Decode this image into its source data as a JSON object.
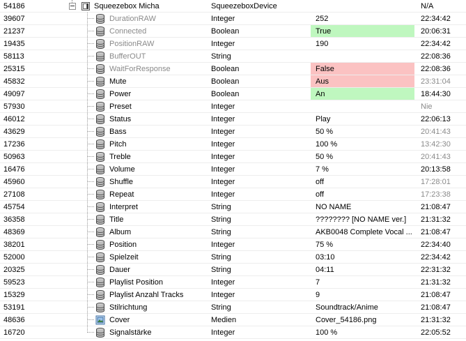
{
  "parent": {
    "id": "54186",
    "name": "Squeezebox Micha",
    "type": "SqueezeboxDevice",
    "value": "",
    "time": "N/A"
  },
  "rows": [
    {
      "id": "39607",
      "name": "DurationRAW",
      "type": "Integer",
      "value": "252",
      "time": "22:34:42",
      "icon": "variable-icon",
      "dim": true,
      "tdim": false,
      "hl": ""
    },
    {
      "id": "21237",
      "name": "Connected",
      "type": "Boolean",
      "value": "True",
      "time": "20:06:31",
      "icon": "variable-icon",
      "dim": true,
      "tdim": false,
      "hl": "green"
    },
    {
      "id": "19435",
      "name": "PositionRAW",
      "type": "Integer",
      "value": "190",
      "time": "22:34:42",
      "icon": "variable-icon",
      "dim": true,
      "tdim": false,
      "hl": ""
    },
    {
      "id": "58113",
      "name": "BufferOUT",
      "type": "String",
      "value": "",
      "time": "22:08:36",
      "icon": "variable-icon",
      "dim": true,
      "tdim": false,
      "hl": ""
    },
    {
      "id": "25315",
      "name": "WaitForResponse",
      "type": "Boolean",
      "value": "False",
      "time": "22:08:36",
      "icon": "variable-icon",
      "dim": true,
      "tdim": false,
      "hl": "red"
    },
    {
      "id": "45832",
      "name": "Mute",
      "type": "Boolean",
      "value": "Aus",
      "time": "23:31:04",
      "icon": "variable-icon",
      "dim": false,
      "tdim": true,
      "hl": "red"
    },
    {
      "id": "49097",
      "name": "Power",
      "type": "Boolean",
      "value": "An",
      "time": "18:44:30",
      "icon": "variable-icon",
      "dim": false,
      "tdim": false,
      "hl": "green"
    },
    {
      "id": "57930",
      "name": "Preset",
      "type": "Integer",
      "value": "",
      "time": "Nie",
      "icon": "variable-icon",
      "dim": false,
      "tdim": true,
      "hl": ""
    },
    {
      "id": "46012",
      "name": "Status",
      "type": "Integer",
      "value": "Play",
      "time": "22:06:13",
      "icon": "variable-icon",
      "dim": false,
      "tdim": false,
      "hl": ""
    },
    {
      "id": "43629",
      "name": "Bass",
      "type": "Integer",
      "value": "50 %",
      "time": "20:41:43",
      "icon": "variable-icon",
      "dim": false,
      "tdim": true,
      "hl": ""
    },
    {
      "id": "17236",
      "name": "Pitch",
      "type": "Integer",
      "value": "100 %",
      "time": "13:42:30",
      "icon": "variable-icon",
      "dim": false,
      "tdim": true,
      "hl": ""
    },
    {
      "id": "50963",
      "name": "Treble",
      "type": "Integer",
      "value": "50 %",
      "time": "20:41:43",
      "icon": "variable-icon",
      "dim": false,
      "tdim": true,
      "hl": ""
    },
    {
      "id": "16476",
      "name": "Volume",
      "type": "Integer",
      "value": "7 %",
      "time": "20:13:58",
      "icon": "variable-icon",
      "dim": false,
      "tdim": false,
      "hl": ""
    },
    {
      "id": "45960",
      "name": "Shuffle",
      "type": "Integer",
      "value": "off",
      "time": "17:28:01",
      "icon": "variable-icon",
      "dim": false,
      "tdim": true,
      "hl": ""
    },
    {
      "id": "27108",
      "name": "Repeat",
      "type": "Integer",
      "value": "off",
      "time": "17:23:38",
      "icon": "variable-icon",
      "dim": false,
      "tdim": true,
      "hl": ""
    },
    {
      "id": "45754",
      "name": "Interpret",
      "type": "String",
      "value": "NO NAME",
      "time": "21:08:47",
      "icon": "variable-icon",
      "dim": false,
      "tdim": false,
      "hl": ""
    },
    {
      "id": "36358",
      "name": "Title",
      "type": "String",
      "value": "???????? [NO NAME ver.]",
      "time": "21:31:32",
      "icon": "variable-icon",
      "dim": false,
      "tdim": false,
      "hl": ""
    },
    {
      "id": "48369",
      "name": "Album",
      "type": "String",
      "value": "AKB0048 Complete Vocal ...",
      "time": "21:08:47",
      "icon": "variable-icon",
      "dim": false,
      "tdim": false,
      "hl": ""
    },
    {
      "id": "38201",
      "name": "Position",
      "type": "Integer",
      "value": "75 %",
      "time": "22:34:40",
      "icon": "variable-icon",
      "dim": false,
      "tdim": false,
      "hl": ""
    },
    {
      "id": "52000",
      "name": "Spielzeit",
      "type": "String",
      "value": "03:10",
      "time": "22:34:42",
      "icon": "variable-icon",
      "dim": false,
      "tdim": false,
      "hl": ""
    },
    {
      "id": "20325",
      "name": "Dauer",
      "type": "String",
      "value": "04:11",
      "time": "22:31:32",
      "icon": "variable-icon",
      "dim": false,
      "tdim": false,
      "hl": ""
    },
    {
      "id": "59523",
      "name": "Playlist Position",
      "type": "Integer",
      "value": "7",
      "time": "21:31:32",
      "icon": "variable-icon",
      "dim": false,
      "tdim": false,
      "hl": ""
    },
    {
      "id": "15329",
      "name": "Playlist Anzahl Tracks",
      "type": "Integer",
      "value": "9",
      "time": "21:08:47",
      "icon": "variable-icon",
      "dim": false,
      "tdim": false,
      "hl": ""
    },
    {
      "id": "53191",
      "name": "Stilrichtung",
      "type": "String",
      "value": "Soundtrack/Anime",
      "time": "21:08:47",
      "icon": "variable-icon",
      "dim": false,
      "tdim": false,
      "hl": ""
    },
    {
      "id": "48636",
      "name": "Cover",
      "type": "Medien",
      "value": "Cover_54186.png",
      "time": "21:31:32",
      "icon": "media-icon",
      "dim": false,
      "tdim": false,
      "hl": ""
    },
    {
      "id": "16720",
      "name": "Signalstärke",
      "type": "Integer",
      "value": "100 %",
      "time": "22:05:52",
      "icon": "variable-icon",
      "dim": false,
      "tdim": false,
      "hl": ""
    }
  ]
}
